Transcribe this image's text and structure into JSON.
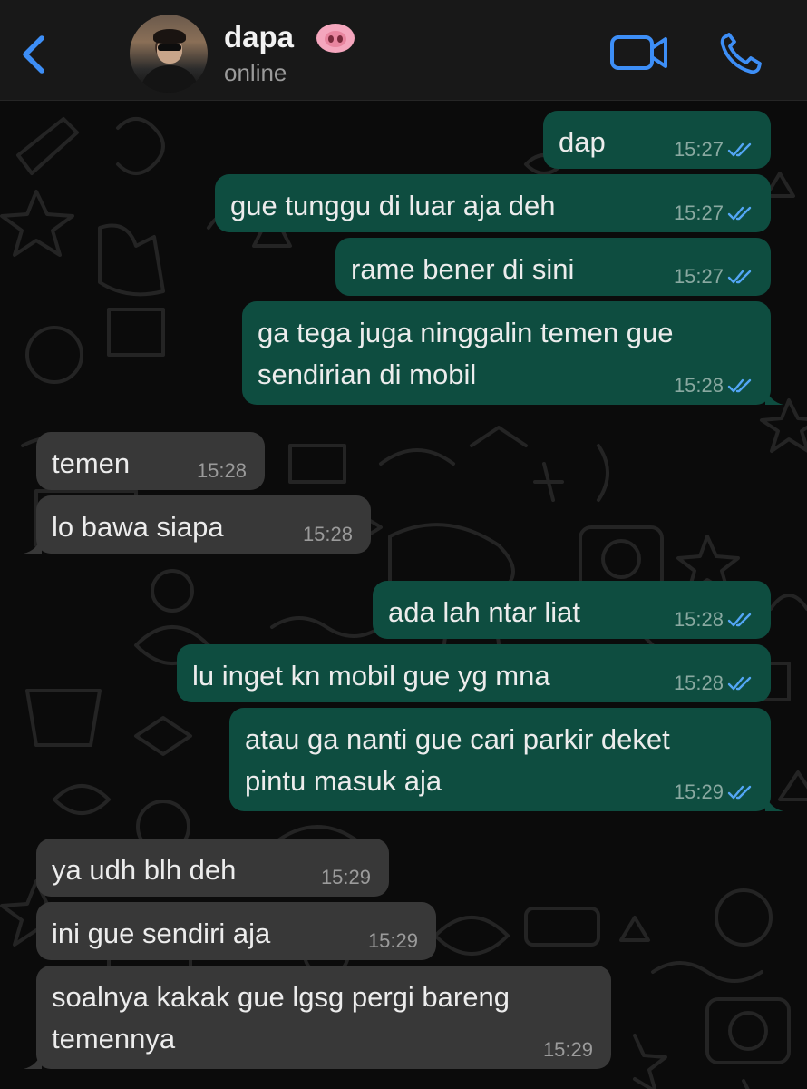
{
  "header": {
    "contact_name": "dapa",
    "status": "online",
    "colors": {
      "accent": "#3d8ef6",
      "header_bg": "#181818"
    },
    "icons": [
      "chevron-left-icon",
      "pig-face-emoji",
      "video-camera-icon",
      "phone-icon"
    ]
  },
  "chat": {
    "colors": {
      "outgoing_bubble": "#0e4d40",
      "incoming_bubble": "#383838",
      "read_ticks": "#53a6f5"
    },
    "messages": [
      {
        "text": "dap",
        "time": "15:27",
        "dir": "out"
      },
      {
        "text": "gue tunggu di luar aja deh",
        "time": "15:27",
        "dir": "out"
      },
      {
        "text": "rame bener di sini",
        "time": "15:27",
        "dir": "out"
      },
      {
        "text": "ga tega juga ninggalin temen gue\nsendirian di mobil",
        "time": "15:28",
        "dir": "out"
      },
      {
        "text": "temen",
        "time": "15:28",
        "dir": "in"
      },
      {
        "text": "lo bawa siapa",
        "time": "15:28",
        "dir": "in"
      },
      {
        "text": "ada lah ntar liat",
        "time": "15:28",
        "dir": "out"
      },
      {
        "text": "lu inget kn mobil gue yg mna",
        "time": "15:28",
        "dir": "out"
      },
      {
        "text": "atau ga nanti gue cari parkir deket\npintu masuk aja",
        "time": "15:29",
        "dir": "out"
      },
      {
        "text": "ya udh blh deh",
        "time": "15:29",
        "dir": "in"
      },
      {
        "text": "ini gue sendiri aja",
        "time": "15:29",
        "dir": "in"
      },
      {
        "text": "soalnya kakak gue lgsg pergi bareng\ntemennya",
        "time": "15:29",
        "dir": "in"
      }
    ]
  }
}
